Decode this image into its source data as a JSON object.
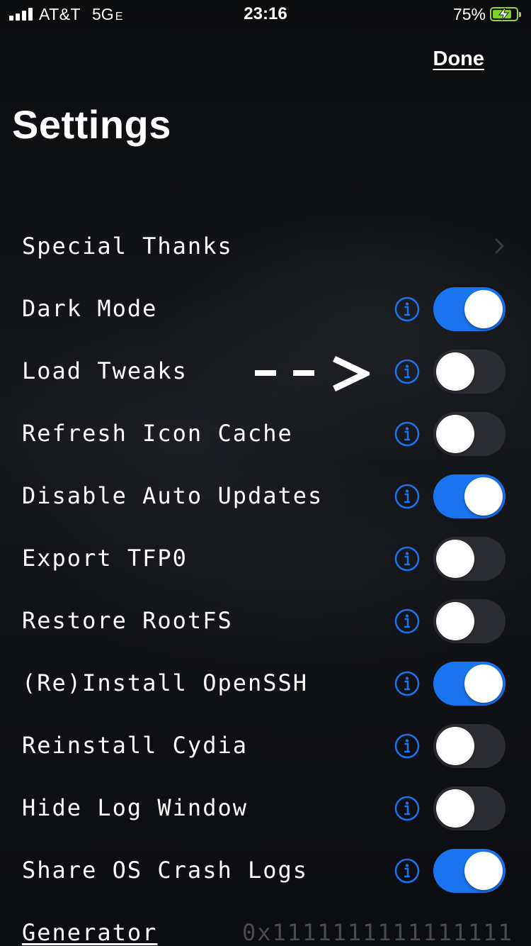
{
  "status_bar": {
    "carrier": "AT&T",
    "network": "5G",
    "network_suffix": "E",
    "time": "23:16",
    "battery_percent": "75%"
  },
  "header": {
    "done_label": "Done",
    "title": "Settings"
  },
  "settings": [
    {
      "label": "Special Thanks",
      "type": "link"
    },
    {
      "label": "Dark Mode",
      "type": "toggle",
      "on": true
    },
    {
      "label": "Load Tweaks",
      "type": "toggle",
      "on": false
    },
    {
      "label": "Refresh Icon Cache",
      "type": "toggle",
      "on": false
    },
    {
      "label": "Disable Auto Updates",
      "type": "toggle",
      "on": true
    },
    {
      "label": "Export TFP0",
      "type": "toggle",
      "on": false
    },
    {
      "label": "Restore RootFS",
      "type": "toggle",
      "on": false
    },
    {
      "label": "(Re)Install OpenSSH",
      "type": "toggle",
      "on": true
    },
    {
      "label": "Reinstall Cydia",
      "type": "toggle",
      "on": false
    },
    {
      "label": "Hide Log Window",
      "type": "toggle",
      "on": false
    },
    {
      "label": "Share OS Crash Logs",
      "type": "toggle",
      "on": true
    }
  ],
  "generator": {
    "label": "Generator",
    "value": "0x1111111111111111"
  },
  "colors": {
    "accent": "#1a74f0",
    "toggle_off": "#2c2d32",
    "battery": "#7cd321"
  },
  "icons": {
    "info": "info-circle-icon",
    "chevron": "chevron-right-icon",
    "arrow": "dashed-arrow-annotation"
  }
}
